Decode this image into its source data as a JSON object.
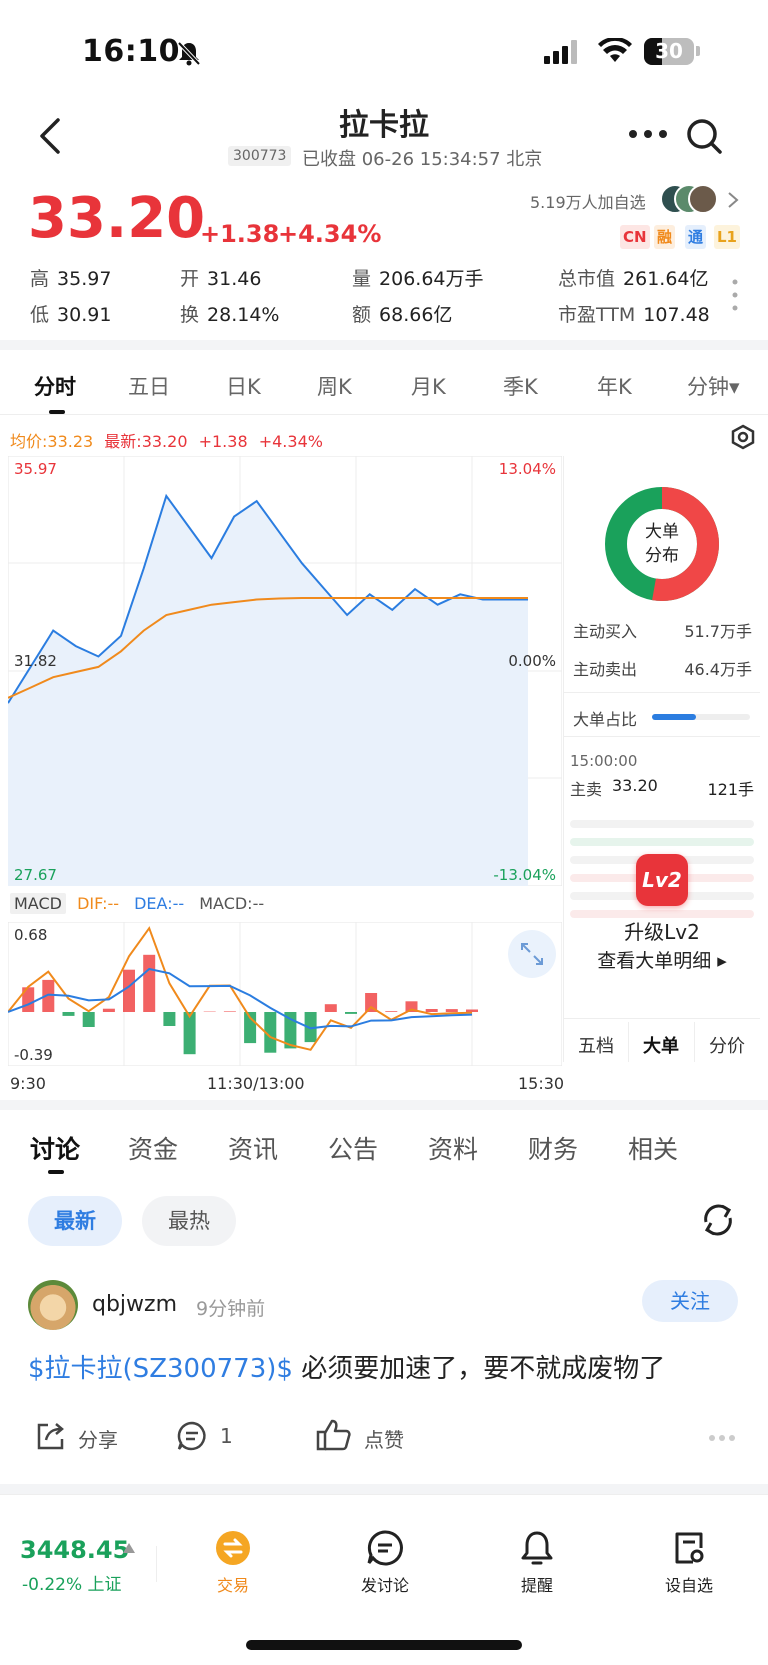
{
  "status_bar": {
    "time": "16:10",
    "battery": "30"
  },
  "header": {
    "title": "拉卡拉",
    "code": "300773",
    "status": "已收盘 06-26 15:34:57 北京"
  },
  "quote": {
    "price": "33.20",
    "change": "+1.38",
    "change_pct": "+4.34%",
    "followers": "5.19万人加自选",
    "tags": [
      "CN",
      "融",
      "通",
      "L1"
    ],
    "stats": {
      "high_label": "高",
      "high": "35.97",
      "open_label": "开",
      "open": "31.46",
      "volume_label": "量",
      "volume": "206.64万手",
      "mcap_label": "总市值",
      "mcap": "261.64亿",
      "low_label": "低",
      "low": "30.91",
      "turnover_label": "换",
      "turnover": "28.14%",
      "amount_label": "额",
      "amount": "68.66亿",
      "pe_label": "市盈TTM",
      "pe": "107.48"
    }
  },
  "chart_tabs": [
    "分时",
    "五日",
    "日K",
    "周K",
    "月K",
    "季K",
    "年K",
    "分钟▾"
  ],
  "intraday": {
    "legend_avg": "均价:33.23",
    "legend_latest": "最新:33.20",
    "legend_change": "+1.38",
    "legend_pct": "+4.34%",
    "y_top": "35.97",
    "y_mid": "31.82",
    "y_bottom": "27.67",
    "pct_top": "13.04%",
    "pct_mid": "0.00%",
    "pct_bottom": "-13.04%",
    "macd_label": "MACD",
    "dif": "DIF:--",
    "dea": "DEA:--",
    "macd": "MACD:--",
    "macd_top": "0.68",
    "macd_bottom": "-0.39",
    "x_start": "9:30",
    "x_mid": "11:30/13:00",
    "x_end": "15:30"
  },
  "chart_data": {
    "type": "line",
    "ylim": [
      27.67,
      35.97
    ],
    "x": [
      "9:30",
      "11:30/13:00",
      "15:30"
    ],
    "series": [
      {
        "values": [
          31.2,
          31.9,
          32.6,
          32.3,
          32.1,
          32.5,
          33.8,
          35.2,
          34.6,
          34.0,
          34.8,
          35.1,
          34.5,
          33.9,
          33.4,
          32.9,
          33.3,
          33.0,
          33.4,
          33.1,
          33.3,
          33.2,
          33.2,
          33.2
        ]
      },
      {
        "values": [
          31.3,
          31.5,
          31.7,
          31.8,
          31.9,
          32.2,
          32.6,
          32.9,
          33.0,
          33.1,
          33.15,
          33.2,
          33.22,
          33.23,
          33.23,
          33.23,
          33.23,
          33.23,
          33.23,
          33.23,
          33.23,
          33.23,
          33.23,
          33.23
        ]
      }
    ]
  },
  "side_panel": {
    "donut_label_1": "大单",
    "donut_label_2": "分布",
    "buy_label": "主动买入",
    "buy_value": "51.7万手",
    "sell_label": "主动卖出",
    "sell_value": "46.4万手",
    "ratio_label": "大单占比",
    "ratio": 0.45,
    "time": "15:00:00",
    "trade_side": "主卖",
    "trade_price": "33.20",
    "trade_qty": "121手",
    "lv2_badge": "Lv2",
    "upgrade_1": "升级Lv2",
    "upgrade_2": "查看大单明细 ▸",
    "tabs": [
      "五档",
      "大单",
      "分价"
    ]
  },
  "discussion": {
    "tabs": [
      "讨论",
      "资金",
      "资讯",
      "公告",
      "资料",
      "财务",
      "相关"
    ],
    "filter_latest": "最新",
    "filter_hot": "最热",
    "post": {
      "user": "qbjwzm",
      "time": "9分钟前",
      "follow": "关注",
      "stock_link": "$拉卡拉(SZ300773)$",
      "text": " 必须要加速了，要不就成废物了",
      "share": "分享",
      "comments": "1",
      "like": "点赞"
    }
  },
  "bottom_bar": {
    "index_value": "3448.45",
    "index_change": "-0.22%",
    "index_name": "上证",
    "trade": "交易",
    "post": "发讨论",
    "alert": "提醒",
    "watch": "设自选"
  }
}
